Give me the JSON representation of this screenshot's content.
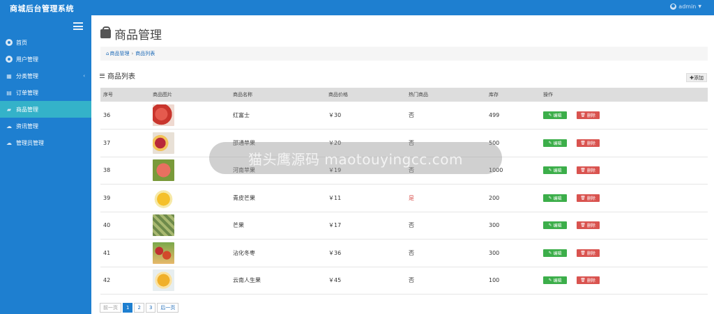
{
  "app": {
    "title": "商城后台管理系统",
    "user": "admin"
  },
  "sidebar": {
    "items": [
      {
        "label": "首页",
        "icon": "dashboard-icon"
      },
      {
        "label": "用户管理",
        "icon": "user-icon"
      },
      {
        "label": "分类管理",
        "icon": "category-icon"
      },
      {
        "label": "订单管理",
        "icon": "order-icon"
      },
      {
        "label": "商品管理",
        "icon": "shopping-bag-icon",
        "active": true
      },
      {
        "label": "资讯管理",
        "icon": "news-icon"
      },
      {
        "label": "管理员管理",
        "icon": "admin-icon"
      }
    ]
  },
  "page": {
    "title": "商品管理",
    "breadcrumb": [
      "商品管理",
      "商品列表"
    ],
    "section_title": "商品列表",
    "add_label": "添加"
  },
  "table": {
    "headers": [
      "序号",
      "商品图片",
      "商品名称",
      "商品价格",
      "热门商品",
      "库存",
      "操作"
    ],
    "rows": [
      {
        "id": "36",
        "name": "红富士",
        "price": "￥30",
        "hot": "否",
        "stock": "499"
      },
      {
        "id": "37",
        "name": "邵通苹果",
        "price": "￥20",
        "hot": "否",
        "stock": "500"
      },
      {
        "id": "38",
        "name": "河南苹果",
        "price": "￥19",
        "hot": "否",
        "stock": "1000"
      },
      {
        "id": "39",
        "name": "青皮芒果",
        "price": "￥11",
        "hot": "是",
        "stock": "200"
      },
      {
        "id": "40",
        "name": "芒果",
        "price": "￥17",
        "hot": "否",
        "stock": "300"
      },
      {
        "id": "41",
        "name": "沾化冬枣",
        "price": "￥36",
        "hot": "否",
        "stock": "300"
      },
      {
        "id": "42",
        "name": "云南人生果",
        "price": "￥45",
        "hot": "否",
        "stock": "100"
      }
    ],
    "edit_label": "编辑",
    "delete_label": "删除"
  },
  "pagination": {
    "prev": "前一页",
    "pages": [
      "1",
      "2",
      "3"
    ],
    "next": "后一页"
  },
  "watermark": "猫头鹰源码 maotouyingcc.com",
  "colors": {
    "primary": "#1e7fd0",
    "active": "#34b2c9",
    "edit": "#3cae4a",
    "delete": "#d9534f"
  }
}
